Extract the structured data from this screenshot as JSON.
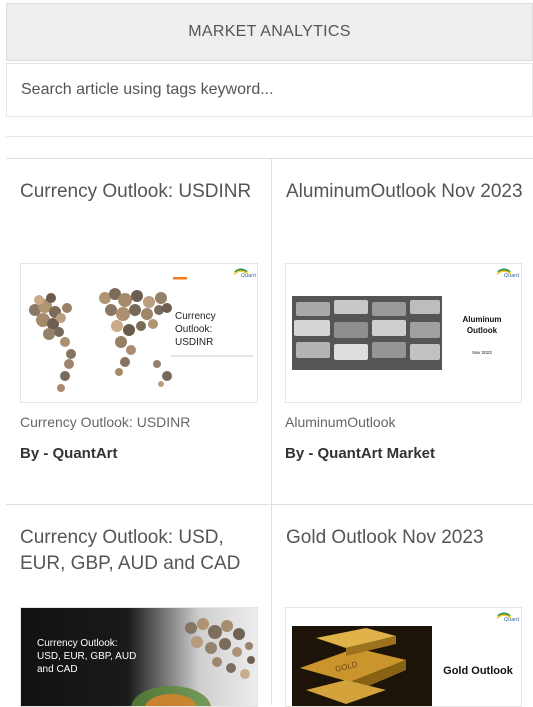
{
  "header": {
    "title": "MARKET ANALYTICS"
  },
  "search": {
    "placeholder": "Search article using tags keyword..."
  },
  "articles": [
    {
      "title": "Currency Outlook: USDINR",
      "thumb_text": [
        "Currency",
        "Outlook:",
        "USDINR"
      ],
      "subtitle": "Currency Outlook: USDINR",
      "author": "By - QuantArt"
    },
    {
      "title": "AluminumOutlook Nov 2023",
      "thumb_text": [
        "Aluminum",
        "Outlook",
        "Nov 2023"
      ],
      "subtitle": "AluminumOutlook",
      "author": "By - QuantArt Market"
    },
    {
      "title": "Currency Outlook: USD, EUR, GBP, AUD and CAD",
      "thumb_text": [
        "Currency Outlook:",
        "USD, EUR, GBP, AUD",
        "and CAD"
      ]
    },
    {
      "title": "Gold Outlook Nov 2023",
      "thumb_text": [
        "Gold Outlook"
      ]
    }
  ],
  "colors": {
    "accent": "#f47b20",
    "header_bg": "#eeeeee",
    "text": "#555555"
  },
  "icons": [
    "quantart-logo-icon",
    "world-map-coins-image",
    "aluminum-ingots-image",
    "gold-bars-image"
  ]
}
